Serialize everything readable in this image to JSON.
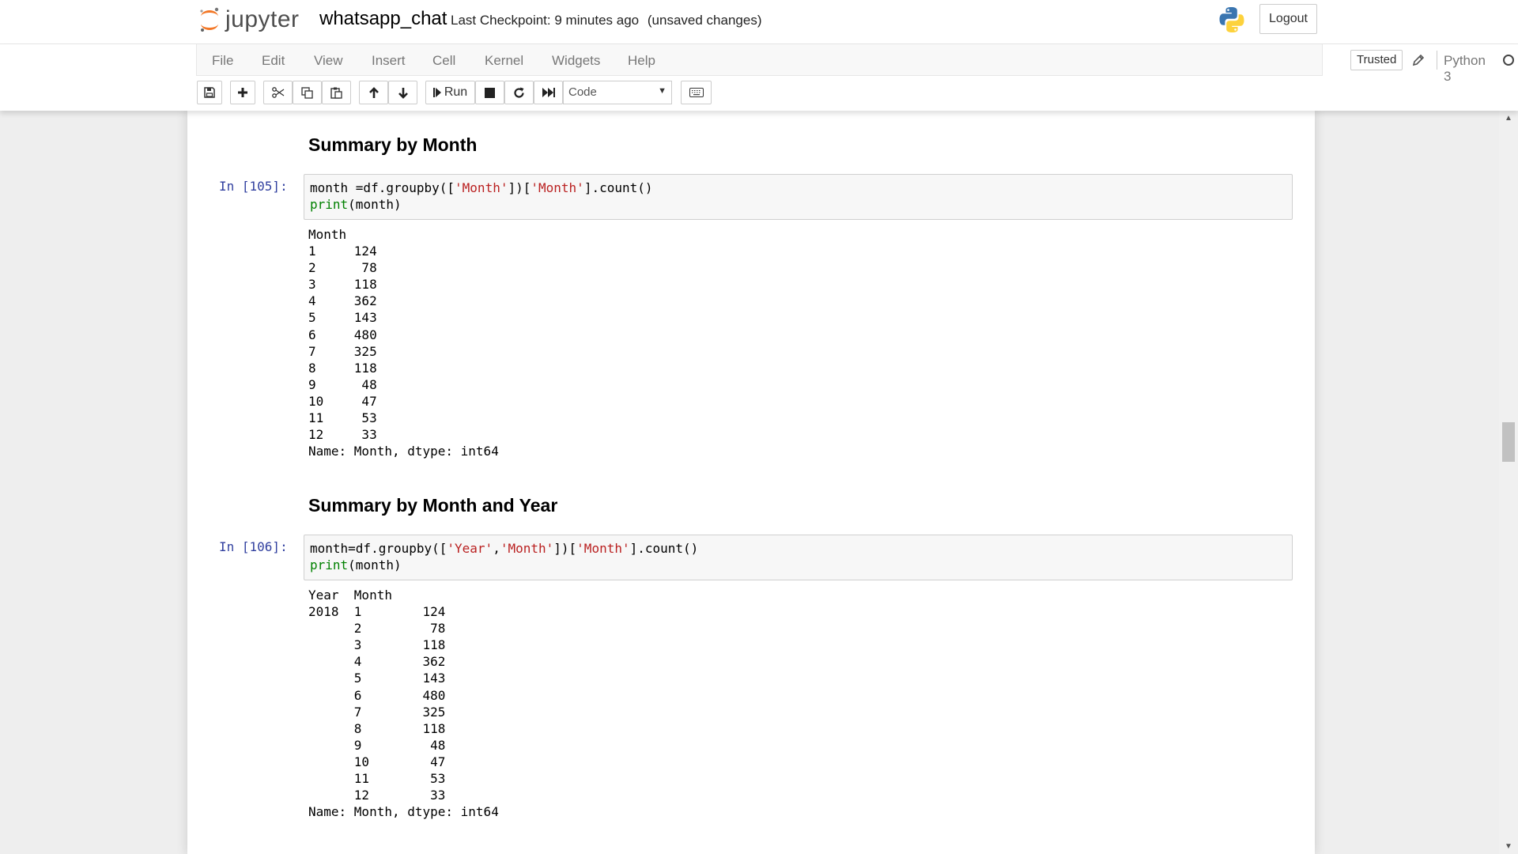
{
  "header": {
    "logo_text": "jupyter",
    "notebook_title": "whatsapp_chat",
    "checkpoint_status": "Last Checkpoint: 9 minutes ago",
    "unsaved_status": "(unsaved changes)",
    "logout_label": "Logout"
  },
  "menubar": {
    "items": [
      {
        "label": "File"
      },
      {
        "label": "Edit"
      },
      {
        "label": "View"
      },
      {
        "label": "Insert"
      },
      {
        "label": "Cell"
      },
      {
        "label": "Kernel"
      },
      {
        "label": "Widgets"
      },
      {
        "label": "Help"
      }
    ],
    "trusted_label": "Trusted",
    "kernel_name": "Python 3"
  },
  "toolbar": {
    "run_label": "Run",
    "cell_type": "Code",
    "buttons": [
      "save-icon",
      "add-cell-icon",
      "cut-icon",
      "copy-icon",
      "paste-icon",
      "move-up-icon",
      "move-down-icon",
      "run-icon",
      "stop-icon",
      "restart-icon",
      "fast-forward-icon",
      "keyboard-icon"
    ]
  },
  "cells": [
    {
      "heading": "Summary by Month",
      "prompt": "In [105]:",
      "code": [
        "month =df.groupby(['Month'])['Month'].count()",
        "print(month)"
      ],
      "output": [
        "Month",
        "1     124",
        "2      78",
        "3     118",
        "4     362",
        "5     143",
        "6     480",
        "7     325",
        "8     118",
        "9      48",
        "10     47",
        "11     53",
        "12     33",
        "Name: Month, dtype: int64"
      ]
    },
    {
      "heading": "Summary by Month and Year",
      "prompt": "In [106]:",
      "code": [
        "month=df.groupby(['Year','Month'])['Month'].count()",
        "print(month)"
      ],
      "output": [
        "Year  Month",
        "2018  1        124",
        "      2         78",
        "      3        118",
        "      4        362",
        "      5        143",
        "      6        480",
        "      7        325",
        "      8        118",
        "      9         48",
        "      10        47",
        "      11        53",
        "      12        33",
        "Name: Month, dtype: int64"
      ]
    }
  ],
  "colors": {
    "jupyter_orange": "#f37726",
    "prompt_blue": "#303f9f",
    "string_red": "#ba2121",
    "builtin_green": "#008000"
  }
}
